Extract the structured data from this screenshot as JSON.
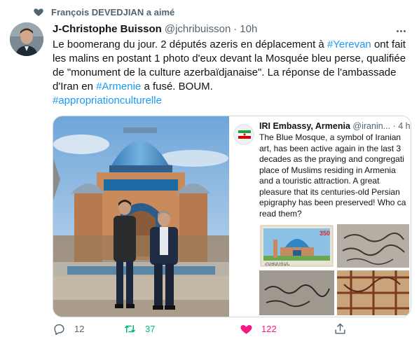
{
  "social_context": {
    "label": "François DEVEDJIAN a aimé"
  },
  "tweet": {
    "author_name": "J-Christophe Buisson",
    "handle": "@jchribuisson",
    "separator": "·",
    "time": "10h",
    "text": {
      "p1": "Le boomerang du jour. 2 députés azeris en déplacement à ",
      "tag1": "#Yerevan",
      "p2": " ont fait les malins en postant 1 photo d'eux devant la Mosquée bleu perse, qualifiée de \"monument de la culture azerbaïdjanaise\". La réponse de l'ambassade d'Iran en ",
      "tag2": "#Armenie",
      "p3": " a fusé. BOUM.",
      "tag3": "#appropriationculturelle"
    }
  },
  "embedded": {
    "name": "IRI Embassy, Armenia",
    "handle_time": "@iranin... · 4 h",
    "lines": [
      "The Blue Mosque, a symbol of Iranian",
      "art, has been active again in the last 3",
      "decades as the praying and congregati",
      "place of Muslims residing in Armenia",
      "and a touristic attraction. A great",
      "pleasure that its centuries-old Persian",
      "epigraphy has been preserved! Who ca",
      "read them?"
    ],
    "stamp_value": "350",
    "stamp_country": "ՀԱՅԱՍՏԱՆ"
  },
  "actions": {
    "replies": "12",
    "retweets": "37",
    "likes": "122"
  },
  "colors": {
    "accent": "#1d9bf0",
    "retweet": "#00ba7c",
    "like": "#f91880",
    "secondary_text": "#536471"
  },
  "icons": [
    "heart-icon",
    "more-icon",
    "reply-icon",
    "retweet-icon",
    "like-icon",
    "share-icon"
  ]
}
